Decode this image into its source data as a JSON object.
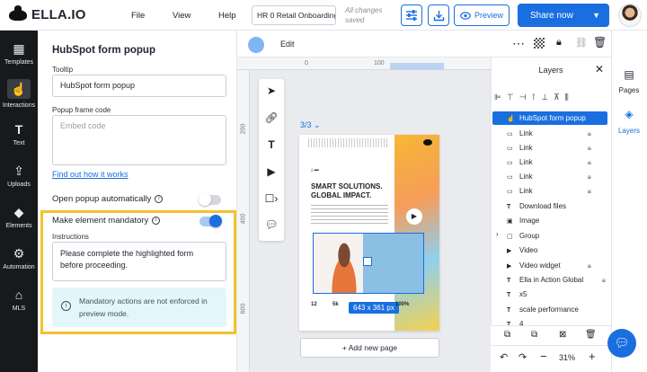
{
  "app": {
    "logo_text": "ELLA.IO"
  },
  "menu": [
    "File",
    "View",
    "Help"
  ],
  "document": {
    "name": "HR 0 Retail Onboarding",
    "save_status": "All changes saved"
  },
  "header": {
    "preview_label": "Preview",
    "share_label": "Share now"
  },
  "left_rail": [
    {
      "label": "Templates",
      "icon": "templates-icon"
    },
    {
      "label": "Interactions",
      "icon": "interactions-icon"
    },
    {
      "label": "Text",
      "icon": "text-icon"
    },
    {
      "label": "Uploads",
      "icon": "uploads-icon"
    },
    {
      "label": "Elements",
      "icon": "elements-icon"
    },
    {
      "label": "Automation",
      "icon": "automation-icon"
    },
    {
      "label": "MLS",
      "icon": "mls-icon"
    }
  ],
  "properties": {
    "title": "HubSpot form popup",
    "tooltip_label": "Tooltip",
    "tooltip_value": "HubSpot form popup",
    "frame_code_label": "Popup frame code",
    "frame_code_placeholder": "Embed code",
    "find_out_link": "Find out how it works",
    "open_auto_label": "Open popup automatically",
    "open_auto_on": false,
    "mandatory_label": "Make element mandatory",
    "mandatory_on": true,
    "instructions_label": "Instructions",
    "instructions_value": "Please complete the highlighted form before proceeding.",
    "notice_text": "Mandatory actions are not enforced in preview mode."
  },
  "canvas_toolbar": {
    "edit_label": "Edit"
  },
  "canvas": {
    "page_indicator": "3/3",
    "page_heading_line1": "SMART SOLUTIONS.",
    "page_heading_line2": "GLOBAL IMPACT.",
    "dimensions_badge": "643 x 361 px",
    "add_page_label": "+ Add new page",
    "stats": [
      "12",
      "5k",
      "100%"
    ],
    "ruler_h_marks": [
      "0",
      "100"
    ],
    "ruler_v_marks": [
      "200",
      "400",
      "600"
    ]
  },
  "layers": {
    "title": "Layers",
    "items": [
      {
        "label": "HubSpot form popup",
        "icon": "interaction",
        "selected": true,
        "locked": false
      },
      {
        "label": "Link",
        "icon": "link",
        "selected": false,
        "locked": true
      },
      {
        "label": "Link",
        "icon": "link",
        "selected": false,
        "locked": true
      },
      {
        "label": "Link",
        "icon": "link",
        "selected": false,
        "locked": true
      },
      {
        "label": "Link",
        "icon": "link",
        "selected": false,
        "locked": true
      },
      {
        "label": "Link",
        "icon": "link",
        "selected": false,
        "locked": true
      },
      {
        "label": "Download files",
        "icon": "text",
        "selected": false,
        "locked": false
      },
      {
        "label": "Image",
        "icon": "image",
        "selected": false,
        "locked": false
      },
      {
        "label": "Group",
        "icon": "group",
        "selected": false,
        "locked": false
      },
      {
        "label": "Video",
        "icon": "video",
        "selected": false,
        "locked": false
      },
      {
        "label": "Video widget",
        "icon": "video",
        "selected": false,
        "locked": true
      },
      {
        "label": "Ella in Action Global",
        "icon": "text",
        "selected": false,
        "locked": true
      },
      {
        "label": "x5",
        "icon": "text",
        "selected": false,
        "locked": false
      },
      {
        "label": "scale performance",
        "icon": "text",
        "selected": false,
        "locked": false
      },
      {
        "label": "4",
        "icon": "text",
        "selected": false,
        "locked": false
      }
    ],
    "zoom": "31%"
  },
  "right_rail": [
    {
      "label": "Pages",
      "icon": "pages-icon"
    },
    {
      "label": "Layers",
      "icon": "layers-icon"
    }
  ],
  "colors": {
    "accent": "#1a6fe0",
    "highlight": "#f2c12e",
    "rail_bg": "#17191d",
    "notice_bg": "#e3f7fb"
  }
}
